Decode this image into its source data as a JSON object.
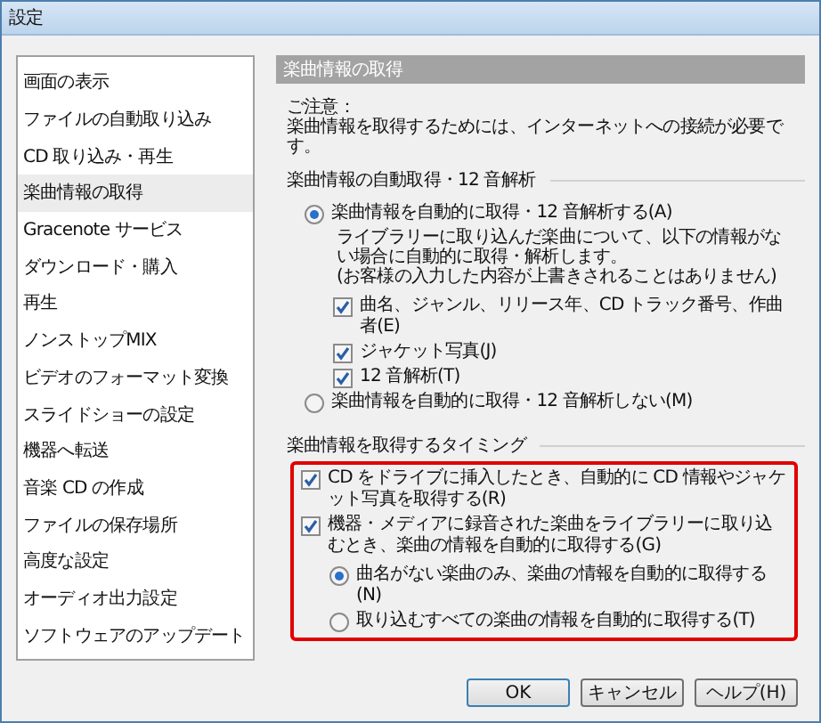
{
  "window": {
    "title": "設定"
  },
  "sidebar": {
    "items": [
      {
        "label": "画面の表示",
        "selected": false
      },
      {
        "label": "ファイルの自動取り込み",
        "selected": false
      },
      {
        "label": "CD 取り込み・再生",
        "selected": false
      },
      {
        "label": "楽曲情報の取得",
        "selected": true
      },
      {
        "label": "Gracenote サービス",
        "selected": false
      },
      {
        "label": "ダウンロード・購入",
        "selected": false
      },
      {
        "label": "再生",
        "selected": false
      },
      {
        "label": "ノンストップMIX",
        "selected": false
      },
      {
        "label": "ビデオのフォーマット変換",
        "selected": false
      },
      {
        "label": "スライドショーの設定",
        "selected": false
      },
      {
        "label": "機器へ転送",
        "selected": false
      },
      {
        "label": "音楽 CD の作成",
        "selected": false
      },
      {
        "label": "ファイルの保存場所",
        "selected": false
      },
      {
        "label": "高度な設定",
        "selected": false
      },
      {
        "label": "オーディオ出力設定",
        "selected": false
      },
      {
        "label": "ソフトウェアのアップデート",
        "selected": false
      }
    ]
  },
  "panel": {
    "header": "楽曲情報の取得",
    "notice": [
      "ご注意：",
      "楽曲情報を取得するためには、インターネットへの接続が必要です。"
    ],
    "groups": [
      {
        "label": "楽曲情報の自動取得・12 音解析",
        "highlighted": false,
        "items": [
          {
            "kind": "radio",
            "label": "楽曲情報を自動的に取得・12 音解析する(A)",
            "selected": true,
            "description": [
              "ライブラリーに取り込んだ楽曲について、以下の情報がない場合に自動的に取得・解析します。",
              "(お客様の入力した内容が上書きされることはありません)"
            ],
            "children": [
              {
                "kind": "checkbox",
                "label": "曲名、ジャンル、リリース年、CD トラック番号、作曲者(E)",
                "checked": true
              },
              {
                "kind": "checkbox",
                "label": "ジャケット写真(J)",
                "checked": true
              },
              {
                "kind": "checkbox",
                "label": "12 音解析(T)",
                "checked": true
              }
            ]
          },
          {
            "kind": "radio",
            "label": "楽曲情報を自動的に取得・12 音解析しない(M)",
            "selected": false
          }
        ]
      },
      {
        "label": "楽曲情報を取得するタイミング",
        "highlighted": true,
        "items": [
          {
            "kind": "checkbox",
            "label": "CD をドライブに挿入したとき、自動的に CD 情報やジャケット写真を取得する(R)",
            "checked": true
          },
          {
            "kind": "checkbox",
            "label": "機器・メディアに録音された楽曲をライブラリーに取り込むとき、楽曲の情報を自動的に取得する(G)",
            "checked": true,
            "children": [
              {
                "kind": "radio",
                "label": "曲名がない楽曲のみ、楽曲の情報を自動的に取得する(N)",
                "selected": true
              },
              {
                "kind": "radio",
                "label": "取り込むすべての楽曲の情報を自動的に取得する(T)",
                "selected": false
              }
            ]
          }
        ]
      }
    ]
  },
  "buttons": [
    {
      "label": "OK",
      "default": true
    },
    {
      "label": "キャンセル",
      "default": false
    },
    {
      "label": "ヘルプ(H)",
      "default": false
    }
  ]
}
